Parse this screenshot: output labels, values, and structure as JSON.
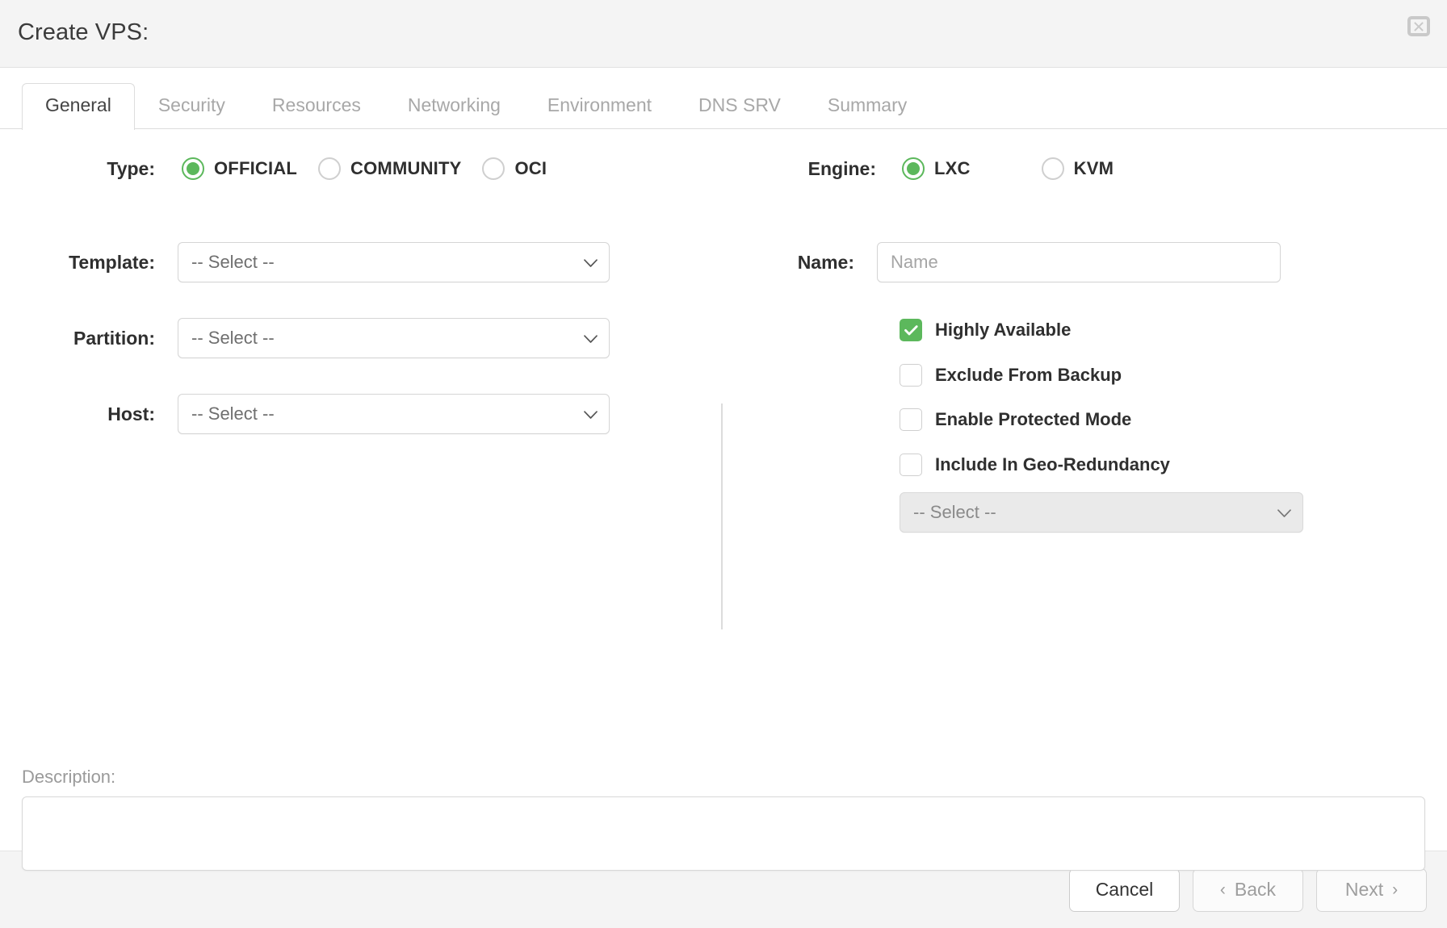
{
  "header": {
    "title": "Create VPS:",
    "close_icon": "close-icon"
  },
  "tabs": [
    {
      "label": "General",
      "active": true
    },
    {
      "label": "Security",
      "active": false
    },
    {
      "label": "Resources",
      "active": false
    },
    {
      "label": "Networking",
      "active": false
    },
    {
      "label": "Environment",
      "active": false
    },
    {
      "label": "DNS SRV",
      "active": false
    },
    {
      "label": "Summary",
      "active": false
    }
  ],
  "form": {
    "type": {
      "label": "Type:",
      "options": [
        {
          "label": "OFFICIAL",
          "selected": true
        },
        {
          "label": "COMMUNITY",
          "selected": false
        },
        {
          "label": "OCI",
          "selected": false
        }
      ]
    },
    "engine": {
      "label": "Engine:",
      "options": [
        {
          "label": "LXC",
          "selected": true
        },
        {
          "label": "KVM",
          "selected": false
        }
      ]
    },
    "template": {
      "label": "Template:",
      "value": "-- Select --"
    },
    "partition": {
      "label": "Partition:",
      "value": "-- Select --"
    },
    "host": {
      "label": "Host:",
      "value": "-- Select --"
    },
    "name": {
      "label": "Name:",
      "value": "",
      "placeholder": "Name"
    },
    "checkboxes": [
      {
        "label": "Highly Available",
        "checked": true
      },
      {
        "label": "Exclude From Backup",
        "checked": false
      },
      {
        "label": "Enable Protected Mode",
        "checked": false
      },
      {
        "label": "Include In Geo-Redundancy",
        "checked": false
      }
    ],
    "geo_select": {
      "value": "-- Select --",
      "disabled": true
    },
    "description": {
      "label": "Description:",
      "value": "",
      "placeholder": ""
    }
  },
  "footer": {
    "cancel": "Cancel",
    "back": "Back",
    "back_caret": "‹",
    "next": "Next",
    "next_caret": "›"
  },
  "colors": {
    "accent_green": "#5cb85c",
    "header_bg": "#f4f4f4",
    "border": "#d5d5d5",
    "text": "#2f2f2f",
    "muted_text": "#9a9a9a"
  }
}
